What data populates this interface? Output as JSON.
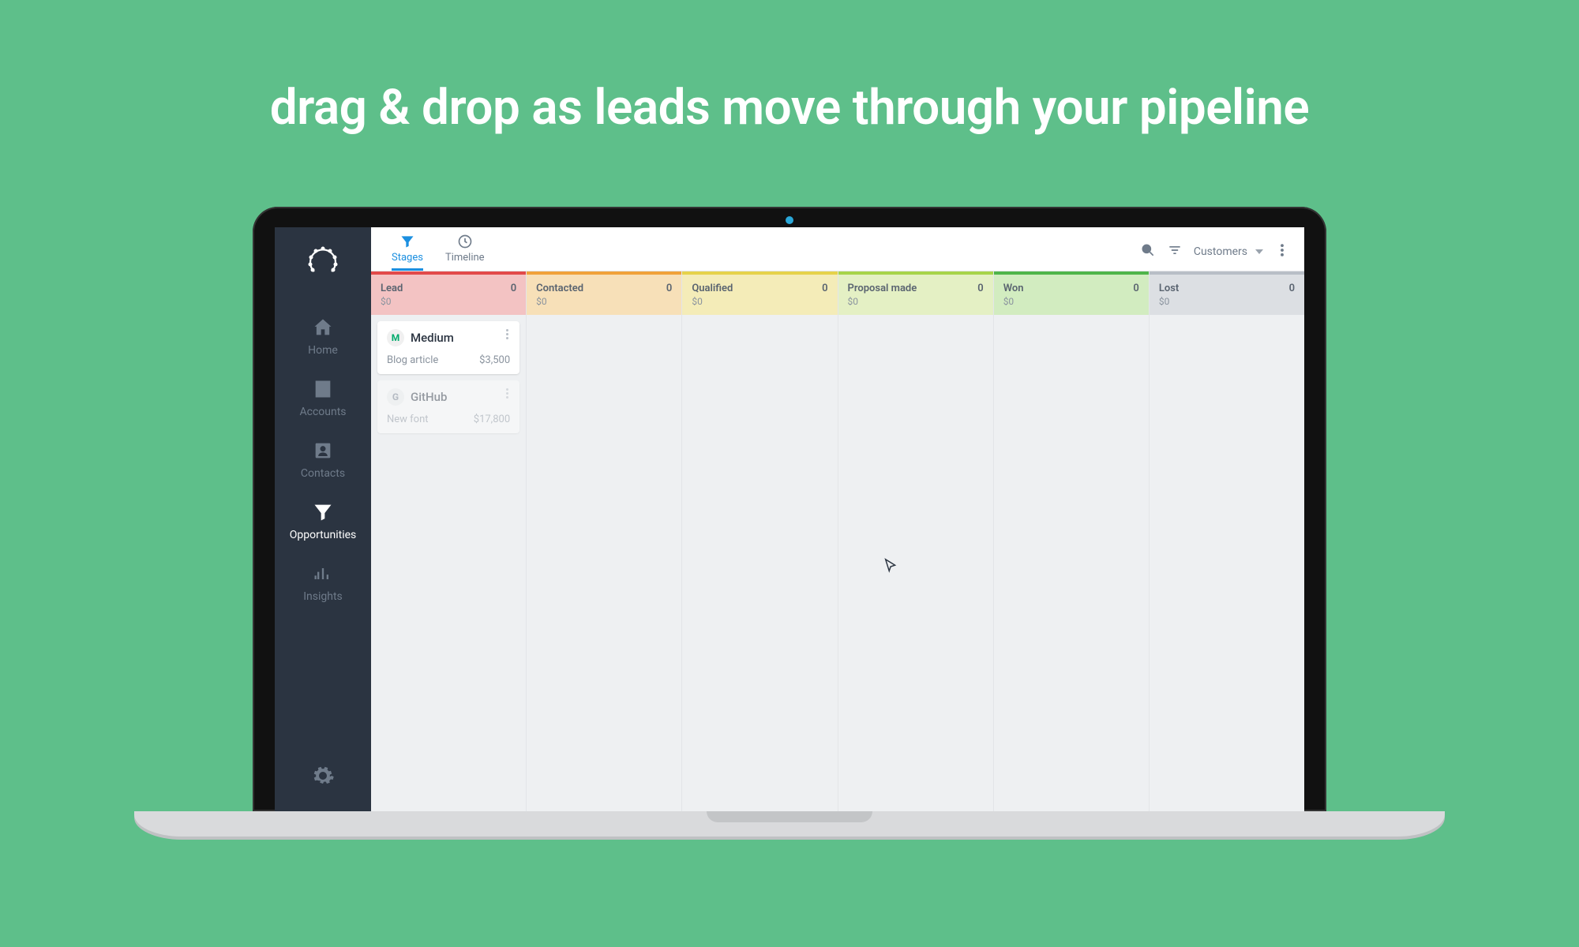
{
  "headline": "drag & drop as leads move through your pipeline",
  "sidebar": {
    "items": [
      {
        "label": "Home"
      },
      {
        "label": "Accounts"
      },
      {
        "label": "Contacts"
      },
      {
        "label": "Opportunities"
      },
      {
        "label": "Insights"
      }
    ]
  },
  "topbar": {
    "tabs": [
      {
        "label": "Stages"
      },
      {
        "label": "Timeline"
      }
    ],
    "pipeline_selected": "Customers"
  },
  "columns": [
    {
      "title": "Lead",
      "count": "0",
      "amount": "$0",
      "line": "#e24a4a",
      "bg": "#f3c3c3"
    },
    {
      "title": "Contacted",
      "count": "0",
      "amount": "$0",
      "line": "#f0a23a",
      "bg": "#f7e0b8"
    },
    {
      "title": "Qualified",
      "count": "0",
      "amount": "$0",
      "line": "#e6d24a",
      "bg": "#f4ecb8"
    },
    {
      "title": "Proposal made",
      "count": "0",
      "amount": "$0",
      "line": "#a7d44a",
      "bg": "#e4f0c4"
    },
    {
      "title": "Won",
      "count": "0",
      "amount": "$0",
      "line": "#4fb54a",
      "bg": "#d2ecc0"
    },
    {
      "title": "Lost",
      "count": "0",
      "amount": "$0",
      "line": "#b8bec6",
      "bg": "#dcdfe3"
    }
  ],
  "cards": [
    {
      "company": "Medium",
      "desc": "Blog article",
      "amount": "$3,500",
      "logo_text": "M",
      "logo_color": "#00ab6c",
      "column": 0,
      "faded": false
    },
    {
      "company": "GitHub",
      "desc": "New font",
      "amount": "$17,800",
      "logo_text": "G",
      "logo_color": "#6f7b8a",
      "column": 0,
      "faded": true
    }
  ]
}
